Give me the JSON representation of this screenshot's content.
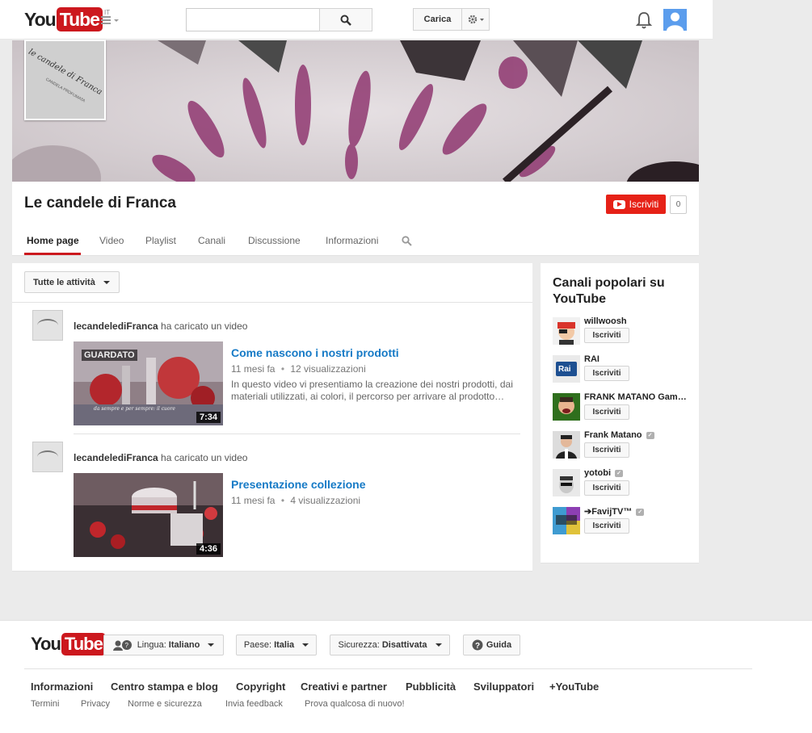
{
  "masthead": {
    "logo_you": "You",
    "logo_tube": "Tube",
    "logo_country": "IT",
    "search_placeholder": "",
    "upload_label": "Carica"
  },
  "channel": {
    "title": "Le candele di Franca",
    "thumb_text": "le candele di Franca",
    "thumb_subtext": "CANDELA PROFUMATA",
    "subscribe_label": "Iscriviti",
    "subscriber_count": "0",
    "tabs": [
      "Home page",
      "Video",
      "Playlist",
      "Canali",
      "Discussione",
      "Informazioni"
    ]
  },
  "feed": {
    "filter_label": "Tutte le attività",
    "items": [
      {
        "user": "lecandelediFranca",
        "action": " ha caricato un video",
        "title": "Come nascono i nostri prodotti",
        "age": "11 mesi fa",
        "views": "12 visualizzazioni",
        "desc_line1": "In questo video vi presentiamo la creazione dei nostri prodotti, dai",
        "desc_line2": "materiali utilizzati, ai colori, il percorso per arrivare al prodotto…",
        "duration": "7:34",
        "watched": "GUARDATO",
        "overlay_caption": "da sempre e per sempre: il cuore"
      },
      {
        "user": "lecandelediFranca",
        "action": " ha caricato un video",
        "title": "Presentazione collezione",
        "age": "11 mesi fa",
        "views": "4 visualizzazioni",
        "duration": "4:36"
      }
    ],
    "dot": "•"
  },
  "sidebar": {
    "title": "Canali popolari su YouTube",
    "subscribe_label": "Iscriviti",
    "channels": [
      {
        "name": "willwoosh",
        "verified": false,
        "color": "#d9342b"
      },
      {
        "name": "RAI",
        "verified": false,
        "color": "#1d4f91"
      },
      {
        "name": "FRANK MATANO Gam…",
        "verified": false,
        "color": "#2f6f1d"
      },
      {
        "name": "Frank Matano",
        "verified": true,
        "color": "#333333"
      },
      {
        "name": "yotobi",
        "verified": true,
        "color": "#e9e9e9"
      },
      {
        "name": "➔FavijTV™",
        "verified": true,
        "color": "#8d3fb3"
      }
    ],
    "rai_text": "Rai"
  },
  "footer": {
    "logo_you": "You",
    "logo_tube": "Tube",
    "language_label": "Lingua:",
    "language_value": "Italiano",
    "country_label": "Paese:",
    "country_value": "Italia",
    "safety_label": "Sicurezza:",
    "safety_value": "Disattivata",
    "help_label": "Guida",
    "links": [
      "Informazioni",
      "Centro stampa e blog",
      "Copyright",
      "Creativi e partner",
      "Pubblicità",
      "Sviluppatori",
      "+YouTube"
    ],
    "links2": [
      "Termini",
      "Privacy",
      "Norme e sicurezza",
      "Invia feedback",
      "Prova qualcosa di nuovo!"
    ]
  },
  "colors": {
    "brand_red": "#cc181e",
    "subscribe_red": "#e62117",
    "link_blue": "#167ac6",
    "avatar_blue": "#5b9ded"
  },
  "icons": [
    "menu-icon",
    "search-icon",
    "gear-icon",
    "bell-icon",
    "avatar-icon",
    "play-icon",
    "verified-icon",
    "language-icon",
    "help-icon",
    "caret-icon"
  ]
}
